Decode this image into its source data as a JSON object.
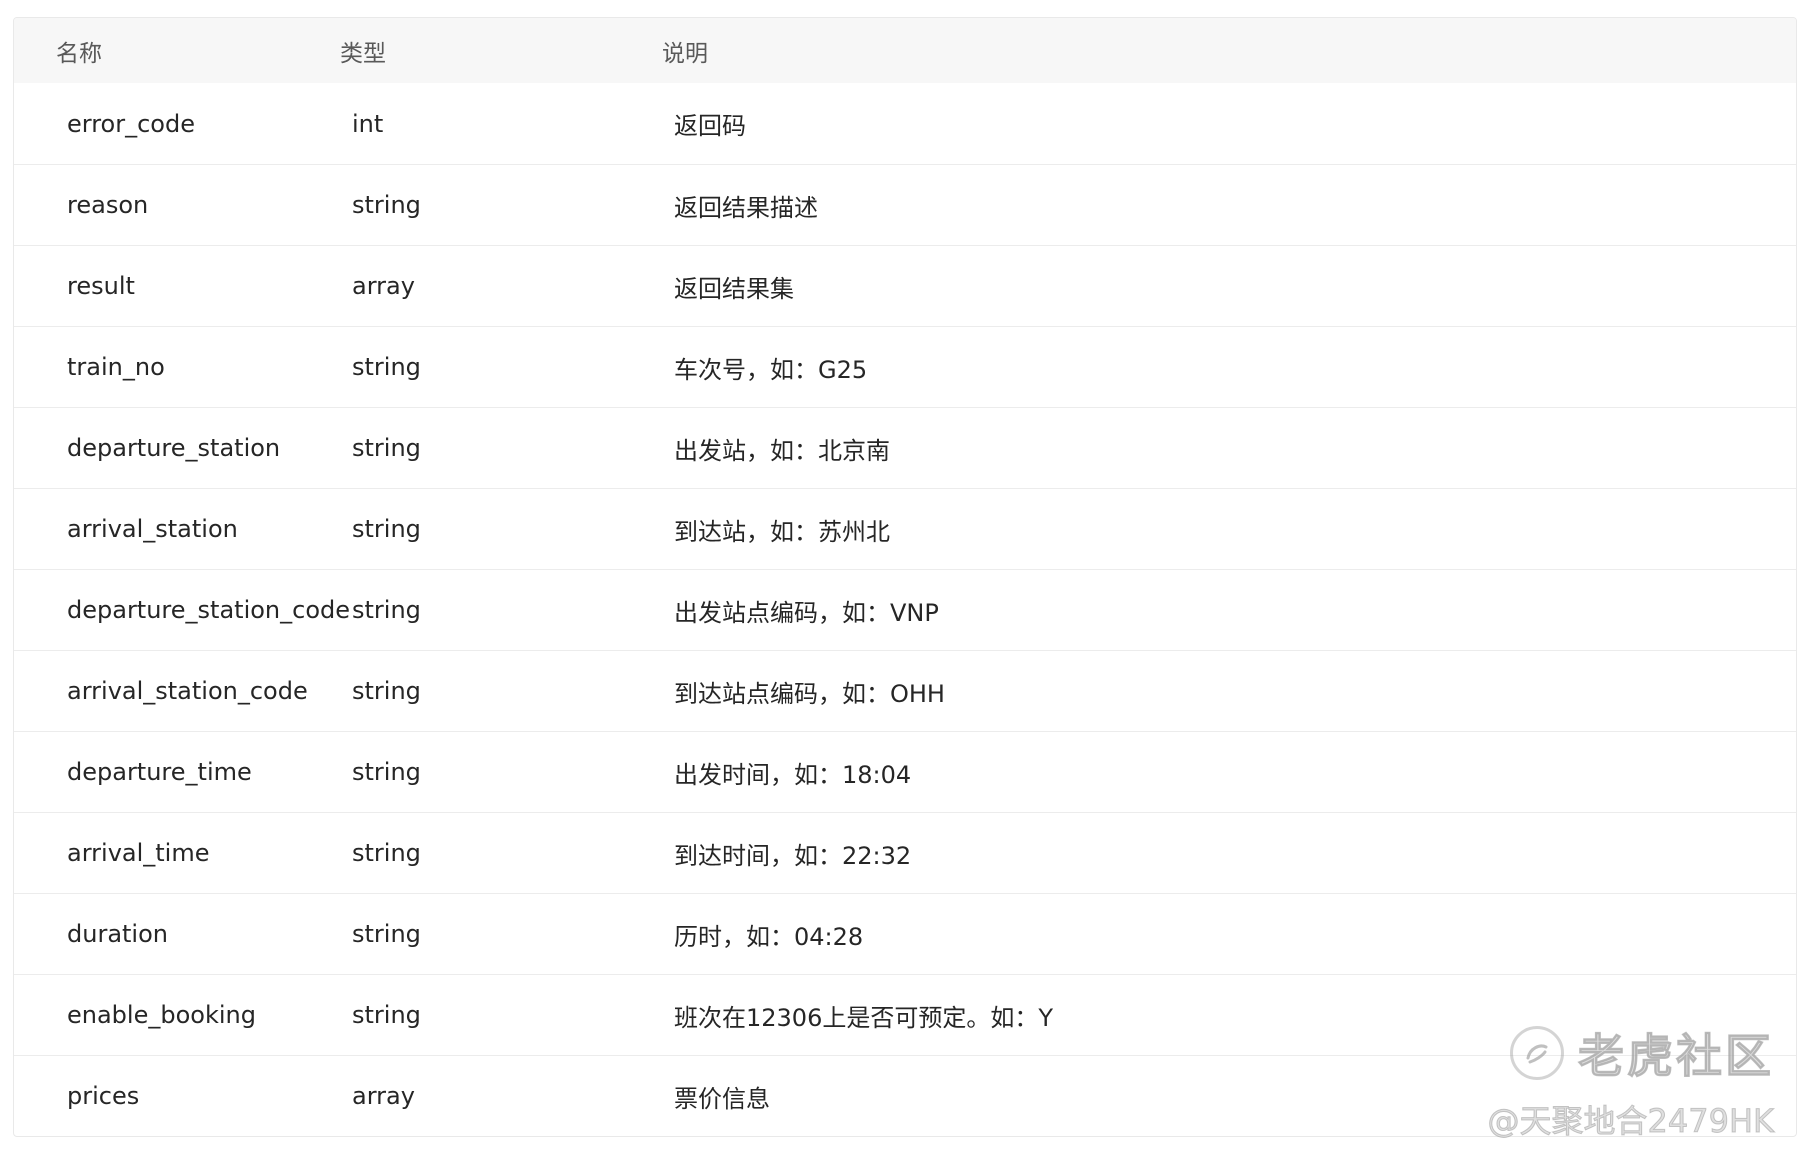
{
  "table": {
    "headers": [
      "名称",
      "类型",
      "说明"
    ],
    "rows": [
      {
        "name": "error_code",
        "type": "int",
        "desc": "返回码"
      },
      {
        "name": "reason",
        "type": "string",
        "desc": "返回结果描述"
      },
      {
        "name": "result",
        "type": "array",
        "desc": "返回结果集"
      },
      {
        "name": "train_no",
        "type": "string",
        "desc": "车次号，如：G25"
      },
      {
        "name": "departure_station",
        "type": "string",
        "desc": "出发站，如：北京南"
      },
      {
        "name": "arrival_station",
        "type": "string",
        "desc": "到达站，如：苏州北"
      },
      {
        "name": "departure_station_code",
        "type": "string",
        "desc": "出发站点编码，如：VNP"
      },
      {
        "name": "arrival_station_code",
        "type": "string",
        "desc": "到达站点编码，如：OHH"
      },
      {
        "name": "departure_time",
        "type": "string",
        "desc": "出发时间，如：18:04"
      },
      {
        "name": "arrival_time",
        "type": "string",
        "desc": "到达时间，如：22:32"
      },
      {
        "name": "duration",
        "type": "string",
        "desc": "历时，如：04:28"
      },
      {
        "name": "enable_booking",
        "type": "string",
        "desc": "班次在12306上是否可预定。如：Y"
      },
      {
        "name": "prices",
        "type": "array",
        "desc": "票价信息"
      }
    ]
  },
  "watermark": {
    "brand": "老虎社区",
    "user": "@天聚地合2479HK",
    "logo_icon": "tiger-logo-icon"
  }
}
